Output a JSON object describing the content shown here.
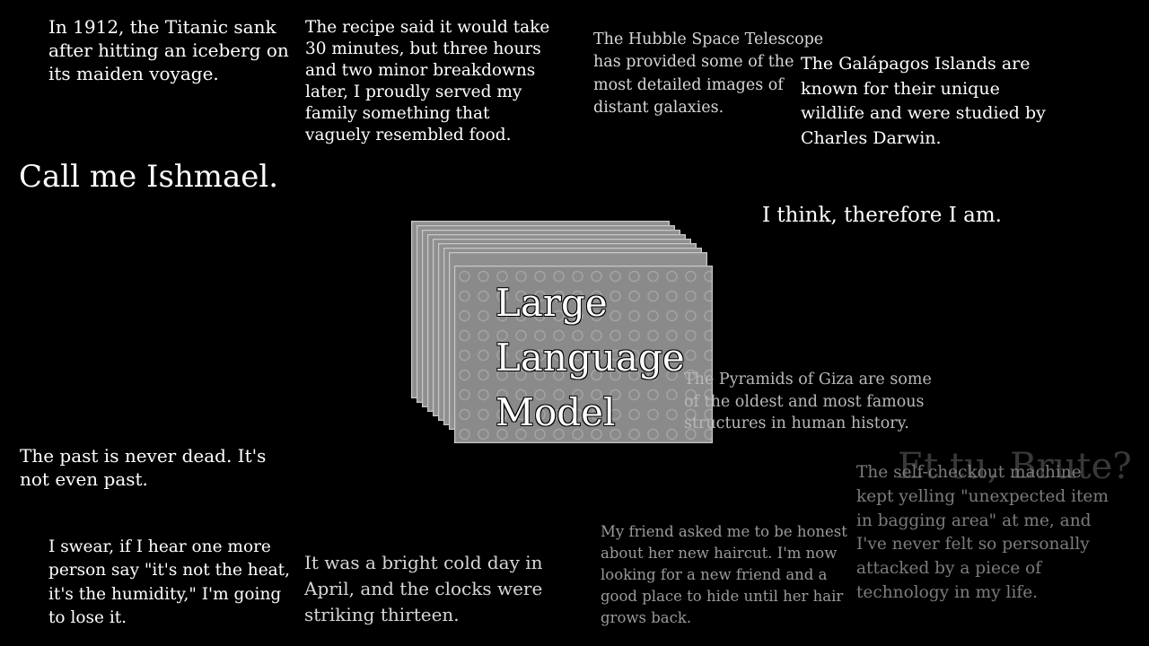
{
  "texts": {
    "titanic": "In 1912, the Titanic sank after hitting an iceberg on its maiden voyage.",
    "recipe": "The recipe said it would take 30 minutes, but three hours and two minor breakdowns later, I proudly served my family something that vaguely resembled food.",
    "hubble": "The Hubble Space Telescope has provided some of the most detailed images of distant galaxies.",
    "galapagos": "The Galápagos Islands are known for their unique wildlife and were studied by Charles Darwin.",
    "ishmael": "Call me Ishmael.",
    "descartes": "I think, therefore I am.",
    "pyramids": "The Pyramids of Giza are some of the oldest and most famous structures in human history.",
    "faulkner": "The past is never dead. It's not even past.",
    "humidity": "I swear, if I hear one more person say \"it's not the heat, it's the humidity,\" I'm going to lose it.",
    "orwell": "It was a bright cold day in April, and the clocks were striking thirteen.",
    "haircut": "My friend asked me to be honest about her new haircut. I'm now looking for a new friend and a good place to hide until her hair grows back.",
    "checkout": "The self-checkout machine kept yelling \"unexpected item in bagging area\" at me, and I've never felt so personally attacked by a piece of technology in my life.",
    "brute": "Et tu, Brute?"
  },
  "llm": {
    "line1": "Large",
    "line2": "Language",
    "line3": "Model"
  }
}
